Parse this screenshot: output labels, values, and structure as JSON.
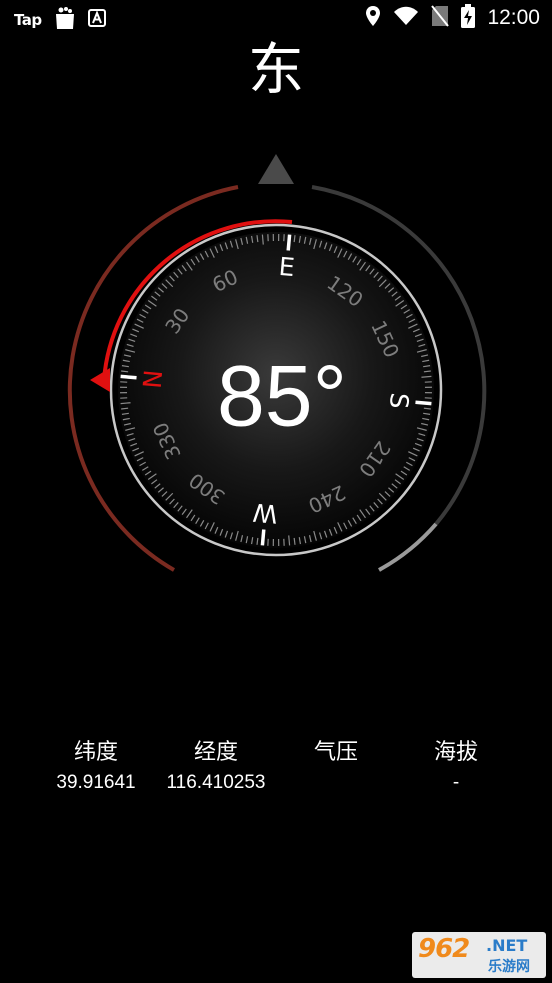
{
  "status_bar": {
    "app_logo": "Tap",
    "time": "12:00",
    "icons": [
      "store-bag-icon",
      "a-box-icon",
      "location-icon",
      "wifi-icon",
      "no-sim-icon",
      "battery-charging-icon"
    ]
  },
  "heading": {
    "direction": "东",
    "degrees": "85°",
    "heading_value": 85
  },
  "compass": {
    "cardinals": {
      "north": "N",
      "east": "E",
      "south": "S",
      "west": "W"
    },
    "degree_labels": [
      "30",
      "60",
      "120",
      "150",
      "210",
      "240",
      "300",
      "330"
    ],
    "colors": {
      "north_accent": "#e01010",
      "ring": "#c8c8c8",
      "tick": "#8a8a8a"
    }
  },
  "info": {
    "latitude": {
      "label": "纬度",
      "value": "39.91641"
    },
    "longitude": {
      "label": "经度",
      "value": "116.410253"
    },
    "pressure": {
      "label": "气压",
      "value": ""
    },
    "altitude": {
      "label": "海拔",
      "value": "-"
    }
  },
  "watermark": {
    "main": "962",
    "net": ".NET",
    "sub": "乐游网"
  }
}
